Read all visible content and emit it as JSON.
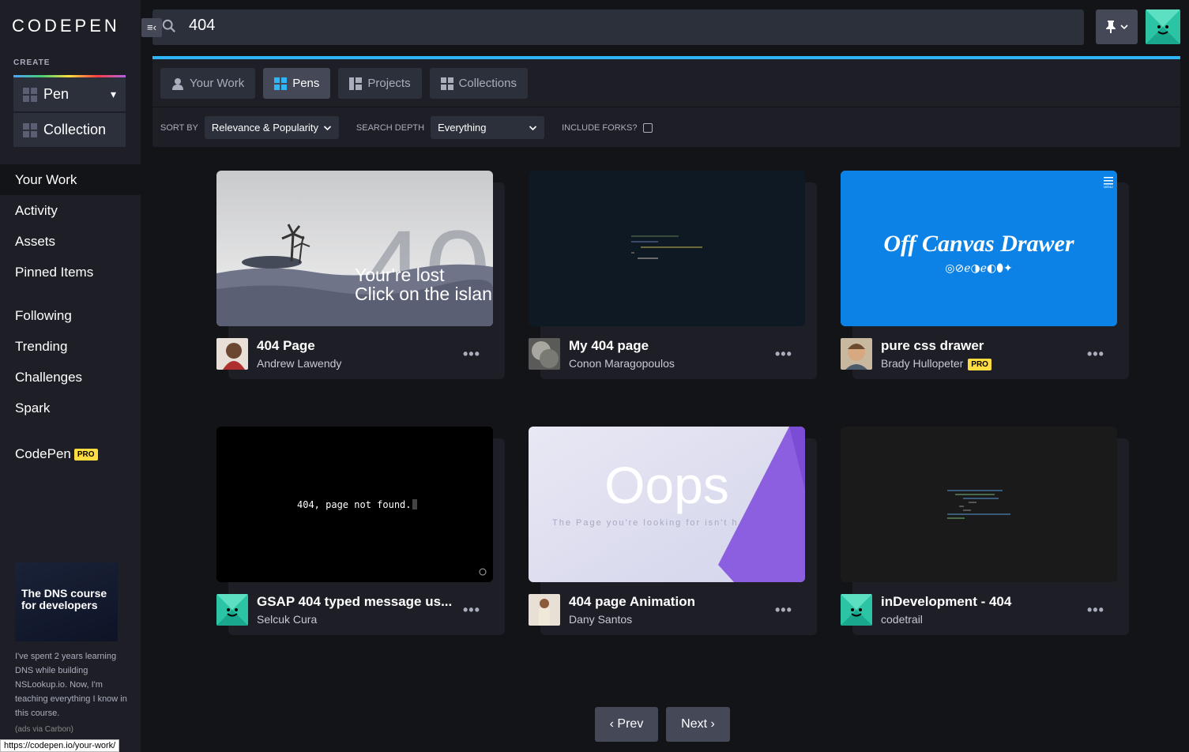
{
  "brand": {
    "logo": "CODEPEN"
  },
  "sidebar": {
    "create_label": "CREATE",
    "create_items": [
      {
        "label": "Pen",
        "chevron": "▾"
      },
      {
        "label": "Collection"
      }
    ],
    "nav_primary": [
      {
        "label": "Your Work"
      },
      {
        "label": "Activity"
      },
      {
        "label": "Assets"
      },
      {
        "label": "Pinned Items"
      }
    ],
    "nav_secondary": [
      {
        "label": "Following"
      },
      {
        "label": "Trending"
      },
      {
        "label": "Challenges"
      },
      {
        "label": "Spark"
      }
    ],
    "codepen_pro": {
      "label": "CodePen",
      "badge": "PRO"
    },
    "ad": {
      "image_text": "The DNS course for developers",
      "body": "I've spent 2 years learning DNS while building NSLookup.io. Now, I'm teaching everything I know in this course.",
      "via": "(ads via Carbon)"
    }
  },
  "status_bar": {
    "url": "https://codepen.io/your-work/"
  },
  "search": {
    "value": "404",
    "collapse_icon": "≡‹"
  },
  "tabs": [
    {
      "label": "Your Work",
      "active": false,
      "icon": "user-icon"
    },
    {
      "label": "Pens",
      "active": true,
      "icon": "pen-grid-icon"
    },
    {
      "label": "Projects",
      "active": false,
      "icon": "project-icon"
    },
    {
      "label": "Collections",
      "active": false,
      "icon": "collection-grid-icon"
    }
  ],
  "filters": {
    "sort_by_label": "SORT BY",
    "sort_by_value": "Relevance & Popularity",
    "search_depth_label": "SEARCH DEPTH",
    "search_depth_value": "Everything",
    "include_forks_label": "INCLUDE FORKS?"
  },
  "pens": [
    {
      "title": "404 Page",
      "author": "Andrew Lawendy",
      "pro": false,
      "preview": {
        "line1": "Your're lost",
        "line2": "Click on the islan",
        "big": "40"
      }
    },
    {
      "title": "My 404 page",
      "author": "Conon Maragopoulos",
      "pro": false
    },
    {
      "title": "pure css drawer",
      "author": "Brady Hullopeter",
      "pro": true,
      "pro_label": "PRO",
      "preview": {
        "heading": "Off Canvas Drawer",
        "icons": "◎⊘ℯ◑ℯ◐⬮✦",
        "menu": "MENU"
      }
    },
    {
      "title": "GSAP 404 typed message us...",
      "author": "Selcuk Cura",
      "pro": false,
      "preview": {
        "typed": "404, page not found."
      }
    },
    {
      "title": "404 page Animation",
      "author": "Dany Santos",
      "pro": false,
      "preview": {
        "heading": "Oops",
        "sub": "The Page you're looking for isn't h"
      }
    },
    {
      "title": "inDevelopment - 404",
      "author": "codetrail",
      "pro": false
    }
  ],
  "more_label": "•••",
  "pagination": {
    "prev": "‹ Prev",
    "next": "Next ›"
  },
  "colors": {
    "accent": "#2fb6f7",
    "pro": "#ffdd40",
    "bg": "#131417",
    "panel": "#1e1f26"
  }
}
